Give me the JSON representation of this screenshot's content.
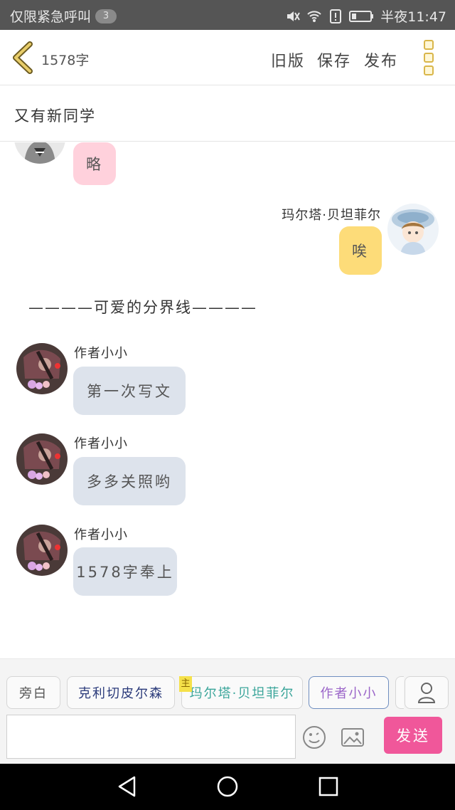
{
  "status_bar": {
    "left_text": "仅限紧急呼叫",
    "badge": "3",
    "time": "半夜11:47",
    "icons": [
      "mute-icon",
      "wifi-icon",
      "alert-icon",
      "battery-icon"
    ]
  },
  "header": {
    "word_count": "1578字",
    "old_version": "旧版",
    "save": "保存",
    "publish": "发布",
    "accent_color": "#d9b64a"
  },
  "story_title": "又有新同学",
  "chat": {
    "partial_message": {
      "text": "略",
      "bubble_color": "#ffd1dc"
    },
    "right_message": {
      "name": "玛尔塔·贝坦菲尔",
      "text": "唉",
      "bubble_color": "#fddc79"
    },
    "divider": "————可爱的分界线————",
    "author_messages": [
      {
        "name": "作者小小",
        "text": "第一次写文"
      },
      {
        "name": "作者小小",
        "text": "多多关照哟"
      },
      {
        "name": "作者小小",
        "text": "1578字奉上"
      }
    ],
    "author_bubble_color": "#dde3ec"
  },
  "toolbar": {
    "roles": {
      "narration": "旁白",
      "role1": "克利切皮尔森",
      "role2": "玛尔塔·贝坦菲尔",
      "role3": "作者小小"
    },
    "main_tag": "主",
    "send": "发送",
    "send_color": "#f0579a"
  }
}
